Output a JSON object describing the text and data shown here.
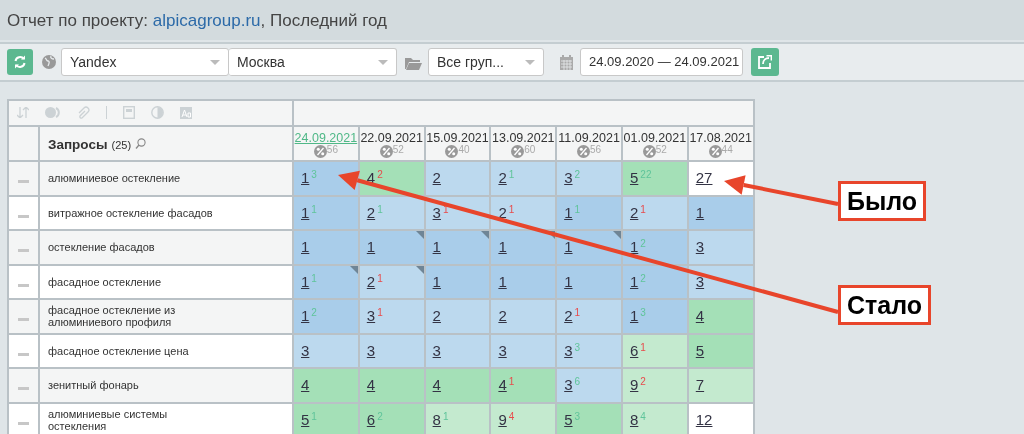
{
  "title": {
    "prefix": "Отчет по проекту:",
    "link": "alpicagroup.ru",
    "suffix": ", Последний год"
  },
  "toolbar": {
    "engine": "Yandex",
    "region": "Москва",
    "group": "Все груп...",
    "date_range": "24.09.2020 — 24.09.2021"
  },
  "table": {
    "query_header": "Запросы",
    "query_count": "(25)",
    "columns": [
      {
        "date": "24.09.2021",
        "score": "56",
        "selected": true
      },
      {
        "date": "22.09.2021",
        "score": "52",
        "selected": false
      },
      {
        "date": "15.09.2021",
        "score": "40",
        "selected": false
      },
      {
        "date": "13.09.2021",
        "score": "60",
        "selected": false
      },
      {
        "date": "11.09.2021",
        "score": "56",
        "selected": false
      },
      {
        "date": "01.09.2021",
        "score": "52",
        "selected": false
      },
      {
        "date": "17.08.2021",
        "score": "44",
        "selected": false
      }
    ],
    "rows": [
      {
        "query": [
          "алюминиевое остекление"
        ],
        "cells": [
          {
            "v": "1",
            "d": "3",
            "rising": true,
            "color": "#a9cdea"
          },
          {
            "v": "4",
            "d": "2",
            "rising": false,
            "color": "#a4e0b7"
          },
          {
            "v": "2",
            "color": "#bcd9ee"
          },
          {
            "v": "2",
            "d": "1",
            "rising": true,
            "color": "#bcd9ee"
          },
          {
            "v": "3",
            "d": "2",
            "rising": true,
            "color": "#bcd9ee"
          },
          {
            "v": "5",
            "d": "22",
            "rising": true,
            "color": "#a4e0b7"
          },
          {
            "v": "27",
            "color": "#ffffff"
          }
        ]
      },
      {
        "query": [
          "витражное остекление фасадов"
        ],
        "cells": [
          {
            "v": "1",
            "d": "1",
            "rising": true,
            "color": "#a9cdea"
          },
          {
            "v": "2",
            "d": "1",
            "rising": true,
            "color": "#bcd9ee"
          },
          {
            "v": "3",
            "d": "1",
            "rising": false,
            "color": "#bcd9ee"
          },
          {
            "v": "2",
            "d": "1",
            "rising": false,
            "color": "#bcd9ee"
          },
          {
            "v": "1",
            "d": "1",
            "rising": true,
            "color": "#a9cdea"
          },
          {
            "v": "2",
            "d": "1",
            "rising": false,
            "color": "#bcd9ee"
          },
          {
            "v": "1",
            "color": "#a9cdea"
          }
        ]
      },
      {
        "query": [
          "остекление фасадов"
        ],
        "cells": [
          {
            "v": "1",
            "color": "#a9cdea"
          },
          {
            "v": "1",
            "color": "#a9cdea",
            "flag": true
          },
          {
            "v": "1",
            "color": "#a9cdea",
            "flag": true
          },
          {
            "v": "1",
            "color": "#a9cdea",
            "flag": true
          },
          {
            "v": "1",
            "color": "#a9cdea",
            "flag": true
          },
          {
            "v": "1",
            "d": "2",
            "rising": true,
            "color": "#a9cdea"
          },
          {
            "v": "3",
            "color": "#bcd9ee"
          }
        ]
      },
      {
        "query": [
          "фасадное остекление"
        ],
        "cells": [
          {
            "v": "1",
            "d": "1",
            "rising": true,
            "color": "#a9cdea",
            "flag": true
          },
          {
            "v": "2",
            "d": "1",
            "rising": false,
            "color": "#bcd9ee",
            "flag": true
          },
          {
            "v": "1",
            "color": "#a9cdea"
          },
          {
            "v": "1",
            "color": "#a9cdea"
          },
          {
            "v": "1",
            "color": "#a9cdea"
          },
          {
            "v": "1",
            "d": "2",
            "rising": true,
            "color": "#a9cdea"
          },
          {
            "v": "3",
            "color": "#bcd9ee"
          }
        ]
      },
      {
        "query": [
          "фасадное остекление из",
          "алюминиевого профиля"
        ],
        "cells": [
          {
            "v": "1",
            "d": "2",
            "rising": true,
            "color": "#a9cdea"
          },
          {
            "v": "3",
            "d": "1",
            "rising": false,
            "color": "#bcd9ee"
          },
          {
            "v": "2",
            "color": "#bcd9ee"
          },
          {
            "v": "2",
            "color": "#bcd9ee"
          },
          {
            "v": "2",
            "d": "1",
            "rising": false,
            "color": "#bcd9ee"
          },
          {
            "v": "1",
            "d": "3",
            "rising": true,
            "color": "#a9cdea"
          },
          {
            "v": "4",
            "color": "#a4e0b7"
          }
        ]
      },
      {
        "query": [
          "фасадное остекление цена"
        ],
        "cells": [
          {
            "v": "3",
            "color": "#bcd9ee"
          },
          {
            "v": "3",
            "color": "#bcd9ee"
          },
          {
            "v": "3",
            "color": "#bcd9ee"
          },
          {
            "v": "3",
            "color": "#bcd9ee"
          },
          {
            "v": "3",
            "d": "3",
            "rising": true,
            "color": "#bcd9ee"
          },
          {
            "v": "6",
            "d": "1",
            "rising": false,
            "color": "#c4eacf"
          },
          {
            "v": "5",
            "color": "#a4e0b7"
          }
        ]
      },
      {
        "query": [
          "зенитный фонарь"
        ],
        "cells": [
          {
            "v": "4",
            "color": "#a4e0b7"
          },
          {
            "v": "4",
            "color": "#a4e0b7"
          },
          {
            "v": "4",
            "color": "#a4e0b7"
          },
          {
            "v": "4",
            "d": "1",
            "rising": false,
            "color": "#a4e0b7"
          },
          {
            "v": "3",
            "d": "6",
            "rising": true,
            "color": "#bcd9ee"
          },
          {
            "v": "9",
            "d": "2",
            "rising": false,
            "color": "#c4eacf"
          },
          {
            "v": "7",
            "color": "#c4eacf"
          }
        ]
      },
      {
        "query": [
          "алюминиевые системы",
          "остекления"
        ],
        "cells": [
          {
            "v": "5",
            "d": "1",
            "rising": true,
            "color": "#a4e0b7"
          },
          {
            "v": "6",
            "d": "2",
            "rising": true,
            "color": "#a4e0b7"
          },
          {
            "v": "8",
            "d": "1",
            "rising": true,
            "color": "#c4eacf"
          },
          {
            "v": "9",
            "d": "4",
            "rising": false,
            "color": "#c4eacf"
          },
          {
            "v": "5",
            "d": "3",
            "rising": true,
            "color": "#a4e0b7"
          },
          {
            "v": "8",
            "d": "4",
            "rising": true,
            "color": "#c4eacf"
          },
          {
            "v": "12",
            "color": "#ffffff"
          }
        ]
      }
    ]
  },
  "annotations": [
    {
      "text": "Было"
    },
    {
      "text": "Стало"
    }
  ]
}
